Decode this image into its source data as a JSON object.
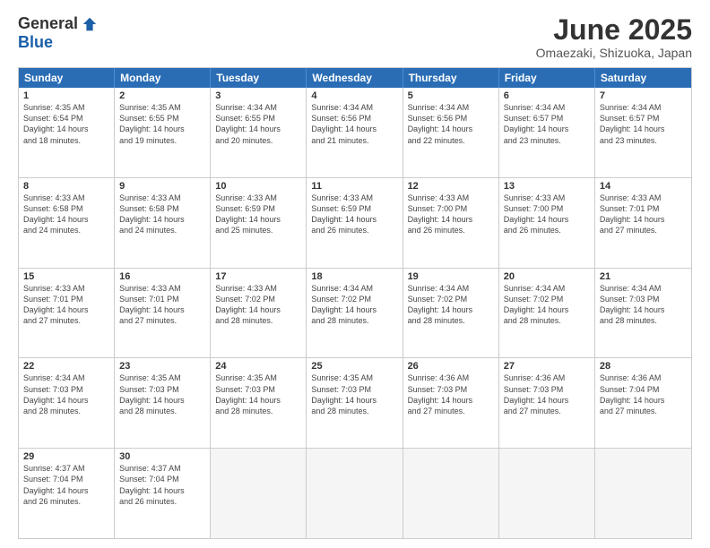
{
  "logo": {
    "general": "General",
    "blue": "Blue"
  },
  "title": "June 2025",
  "location": "Omaezaki, Shizuoka, Japan",
  "weekdays": [
    "Sunday",
    "Monday",
    "Tuesday",
    "Wednesday",
    "Thursday",
    "Friday",
    "Saturday"
  ],
  "rows": [
    [
      {
        "day": "1",
        "lines": [
          "Sunrise: 4:35 AM",
          "Sunset: 6:54 PM",
          "Daylight: 14 hours",
          "and 18 minutes."
        ]
      },
      {
        "day": "2",
        "lines": [
          "Sunrise: 4:35 AM",
          "Sunset: 6:55 PM",
          "Daylight: 14 hours",
          "and 19 minutes."
        ]
      },
      {
        "day": "3",
        "lines": [
          "Sunrise: 4:34 AM",
          "Sunset: 6:55 PM",
          "Daylight: 14 hours",
          "and 20 minutes."
        ]
      },
      {
        "day": "4",
        "lines": [
          "Sunrise: 4:34 AM",
          "Sunset: 6:56 PM",
          "Daylight: 14 hours",
          "and 21 minutes."
        ]
      },
      {
        "day": "5",
        "lines": [
          "Sunrise: 4:34 AM",
          "Sunset: 6:56 PM",
          "Daylight: 14 hours",
          "and 22 minutes."
        ]
      },
      {
        "day": "6",
        "lines": [
          "Sunrise: 4:34 AM",
          "Sunset: 6:57 PM",
          "Daylight: 14 hours",
          "and 23 minutes."
        ]
      },
      {
        "day": "7",
        "lines": [
          "Sunrise: 4:34 AM",
          "Sunset: 6:57 PM",
          "Daylight: 14 hours",
          "and 23 minutes."
        ]
      }
    ],
    [
      {
        "day": "8",
        "lines": [
          "Sunrise: 4:33 AM",
          "Sunset: 6:58 PM",
          "Daylight: 14 hours",
          "and 24 minutes."
        ]
      },
      {
        "day": "9",
        "lines": [
          "Sunrise: 4:33 AM",
          "Sunset: 6:58 PM",
          "Daylight: 14 hours",
          "and 24 minutes."
        ]
      },
      {
        "day": "10",
        "lines": [
          "Sunrise: 4:33 AM",
          "Sunset: 6:59 PM",
          "Daylight: 14 hours",
          "and 25 minutes."
        ]
      },
      {
        "day": "11",
        "lines": [
          "Sunrise: 4:33 AM",
          "Sunset: 6:59 PM",
          "Daylight: 14 hours",
          "and 26 minutes."
        ]
      },
      {
        "day": "12",
        "lines": [
          "Sunrise: 4:33 AM",
          "Sunset: 7:00 PM",
          "Daylight: 14 hours",
          "and 26 minutes."
        ]
      },
      {
        "day": "13",
        "lines": [
          "Sunrise: 4:33 AM",
          "Sunset: 7:00 PM",
          "Daylight: 14 hours",
          "and 26 minutes."
        ]
      },
      {
        "day": "14",
        "lines": [
          "Sunrise: 4:33 AM",
          "Sunset: 7:01 PM",
          "Daylight: 14 hours",
          "and 27 minutes."
        ]
      }
    ],
    [
      {
        "day": "15",
        "lines": [
          "Sunrise: 4:33 AM",
          "Sunset: 7:01 PM",
          "Daylight: 14 hours",
          "and 27 minutes."
        ]
      },
      {
        "day": "16",
        "lines": [
          "Sunrise: 4:33 AM",
          "Sunset: 7:01 PM",
          "Daylight: 14 hours",
          "and 27 minutes."
        ]
      },
      {
        "day": "17",
        "lines": [
          "Sunrise: 4:33 AM",
          "Sunset: 7:02 PM",
          "Daylight: 14 hours",
          "and 28 minutes."
        ]
      },
      {
        "day": "18",
        "lines": [
          "Sunrise: 4:34 AM",
          "Sunset: 7:02 PM",
          "Daylight: 14 hours",
          "and 28 minutes."
        ]
      },
      {
        "day": "19",
        "lines": [
          "Sunrise: 4:34 AM",
          "Sunset: 7:02 PM",
          "Daylight: 14 hours",
          "and 28 minutes."
        ]
      },
      {
        "day": "20",
        "lines": [
          "Sunrise: 4:34 AM",
          "Sunset: 7:02 PM",
          "Daylight: 14 hours",
          "and 28 minutes."
        ]
      },
      {
        "day": "21",
        "lines": [
          "Sunrise: 4:34 AM",
          "Sunset: 7:03 PM",
          "Daylight: 14 hours",
          "and 28 minutes."
        ]
      }
    ],
    [
      {
        "day": "22",
        "lines": [
          "Sunrise: 4:34 AM",
          "Sunset: 7:03 PM",
          "Daylight: 14 hours",
          "and 28 minutes."
        ]
      },
      {
        "day": "23",
        "lines": [
          "Sunrise: 4:35 AM",
          "Sunset: 7:03 PM",
          "Daylight: 14 hours",
          "and 28 minutes."
        ]
      },
      {
        "day": "24",
        "lines": [
          "Sunrise: 4:35 AM",
          "Sunset: 7:03 PM",
          "Daylight: 14 hours",
          "and 28 minutes."
        ]
      },
      {
        "day": "25",
        "lines": [
          "Sunrise: 4:35 AM",
          "Sunset: 7:03 PM",
          "Daylight: 14 hours",
          "and 28 minutes."
        ]
      },
      {
        "day": "26",
        "lines": [
          "Sunrise: 4:36 AM",
          "Sunset: 7:03 PM",
          "Daylight: 14 hours",
          "and 27 minutes."
        ]
      },
      {
        "day": "27",
        "lines": [
          "Sunrise: 4:36 AM",
          "Sunset: 7:03 PM",
          "Daylight: 14 hours",
          "and 27 minutes."
        ]
      },
      {
        "day": "28",
        "lines": [
          "Sunrise: 4:36 AM",
          "Sunset: 7:04 PM",
          "Daylight: 14 hours",
          "and 27 minutes."
        ]
      }
    ],
    [
      {
        "day": "29",
        "lines": [
          "Sunrise: 4:37 AM",
          "Sunset: 7:04 PM",
          "Daylight: 14 hours",
          "and 26 minutes."
        ]
      },
      {
        "day": "30",
        "lines": [
          "Sunrise: 4:37 AM",
          "Sunset: 7:04 PM",
          "Daylight: 14 hours",
          "and 26 minutes."
        ]
      },
      {
        "day": "",
        "lines": []
      },
      {
        "day": "",
        "lines": []
      },
      {
        "day": "",
        "lines": []
      },
      {
        "day": "",
        "lines": []
      },
      {
        "day": "",
        "lines": []
      }
    ]
  ]
}
